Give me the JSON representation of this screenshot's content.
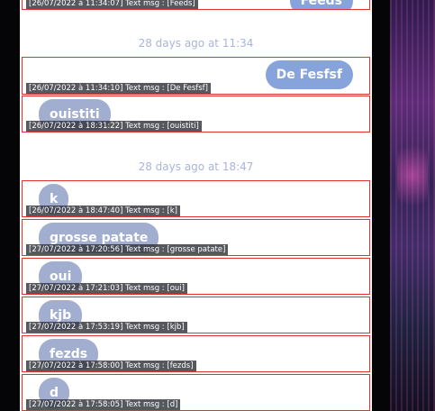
{
  "date_separators": [
    "28 days ago at 11:34",
    "28 days ago at 18:47"
  ],
  "messages": [
    {
      "direction": "out",
      "text": "Feeds",
      "debug": "[26/07/2022 à 11:34:07] Text msg : [Feeds]"
    },
    {
      "direction": "out",
      "text": "De Fesfsf",
      "debug": "[26/07/2022 à 11:34:10] Text msg : [De Fesfsf]"
    },
    {
      "direction": "in",
      "text": "ouistiti",
      "debug": "[26/07/2022 à 18:31:22] Text msg : [ouistiti]"
    },
    {
      "direction": "in",
      "text": "k",
      "debug": "[26/07/2022 à 18:47:40] Text msg : [k]"
    },
    {
      "direction": "in",
      "text": "grosse patate",
      "debug": "[27/07/2022 à 17:20:56] Text msg : [grosse patate]"
    },
    {
      "direction": "in",
      "text": "oui",
      "debug": "[27/07/2022 à 17:21:03] Text msg : [oui]"
    },
    {
      "direction": "in",
      "text": "kjb",
      "debug": "[27/07/2022 à 17:53:19] Text msg : [kjb]"
    },
    {
      "direction": "in",
      "text": "fezds",
      "debug": "[27/07/2022 à 17:58:00] Text msg : [fezds]"
    },
    {
      "direction": "in",
      "text": "d",
      "debug": "[27/07/2022 à 17:58:05] Text msg : [d]"
    }
  ],
  "colors": {
    "outgoing_bubble": "#86a3dc",
    "incoming_bubble": "#a2aed0",
    "debug_border": "#e0322f",
    "date_text": "#a8b5d6"
  }
}
